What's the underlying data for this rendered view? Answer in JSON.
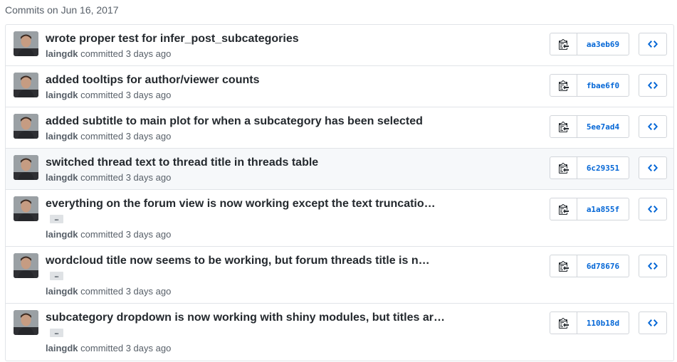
{
  "group_title": "Commits on Jun 16, 2017",
  "colors": {
    "link": "#0366d6",
    "muted": "#586069",
    "border": "#e1e4e8"
  },
  "icons": {
    "copy": "clippy-icon",
    "browse": "code-icon",
    "expand": "ellipsis-icon"
  },
  "commits": [
    {
      "title": "wrote proper test for infer_post_subcategories",
      "author": "laingdk",
      "meta": "committed 3 days ago",
      "sha": "aa3eb69",
      "has_more": false
    },
    {
      "title": "added tooltips for author/viewer counts",
      "author": "laingdk",
      "meta": "committed 3 days ago",
      "sha": "fbae6f0",
      "has_more": false
    },
    {
      "title": "added subtitle to main plot for when a subcategory has been selected",
      "author": "laingdk",
      "meta": "committed 3 days ago",
      "sha": "5ee7ad4",
      "has_more": false
    },
    {
      "title": "switched thread text to thread title in threads table",
      "author": "laingdk",
      "meta": "committed 3 days ago",
      "sha": "6c29351",
      "has_more": false
    },
    {
      "title": "everything on the forum view is now working except the text truncatio…",
      "author": "laingdk",
      "meta": "committed 3 days ago",
      "sha": "a1a855f",
      "has_more": true,
      "more_label": "…"
    },
    {
      "title": "wordcloud title now seems to be working, but forum threads title is n…",
      "author": "laingdk",
      "meta": "committed 3 days ago",
      "sha": "6d78676",
      "has_more": true,
      "more_label": "…"
    },
    {
      "title": "subcategory dropdown is now working with shiny modules, but titles ar…",
      "author": "laingdk",
      "meta": "committed 3 days ago",
      "sha": "110b18d",
      "has_more": true,
      "more_label": "…"
    }
  ]
}
